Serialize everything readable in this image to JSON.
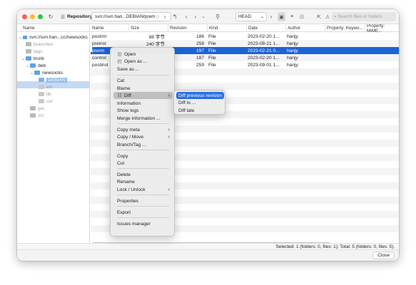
{
  "toolbar": {
    "repository_label": "Repository",
    "path": "svn://svn.han...DEBIAN/prem",
    "revision": "HEAD",
    "search_placeholder": "Search files or folders"
  },
  "tree": {
    "header": "Name",
    "items": [
      {
        "label": "svn://svn.han...cc/newsocks",
        "dim": false
      },
      {
        "label": "branches",
        "dim": true
      },
      {
        "label": "tags",
        "dim": true
      },
      {
        "label": "trunk",
        "dim": false
      },
      {
        "label": "deb",
        "dim": false
      },
      {
        "label": "newsocks",
        "dim": false
      },
      {
        "label": "DEBIAN",
        "dim": false
      },
      {
        "label": "etc",
        "dim": true
      },
      {
        "label": "lib",
        "dim": true
      },
      {
        "label": "usr",
        "dim": true
      },
      {
        "label": "gui",
        "dim": true
      },
      {
        "label": "src",
        "dim": true
      }
    ]
  },
  "table": {
    "columns": [
      "Name",
      "Size",
      "Revision",
      "Kind",
      "Date",
      "Author",
      "Property: Keywo...",
      "Property: MIME..."
    ],
    "rows": [
      {
        "name": "postrm",
        "size": "88 字节",
        "revision": "186",
        "kind": "File",
        "date": "2023-02-20 1...",
        "author": "hanjy"
      },
      {
        "name": "preinst",
        "size": "240 字节",
        "revision": "258",
        "kind": "File",
        "date": "2023-08-21 1...",
        "author": "hanjy"
      },
      {
        "name": "prerm",
        "size": "",
        "revision": "197",
        "kind": "File",
        "date": "2023-02-21 0...",
        "author": "hanjy"
      },
      {
        "name": "control",
        "size": "",
        "revision": "187",
        "kind": "File",
        "date": "2023-02-20 1...",
        "author": "hanjy"
      },
      {
        "name": "postinst",
        "size": "",
        "revision": "259",
        "kind": "File",
        "date": "2023-09-01 1...",
        "author": "hanjy"
      }
    ],
    "selected_row": 2
  },
  "context_menu": {
    "items": {
      "open": "Open",
      "open_as": "Open as ...",
      "save_as": "Save as ...",
      "cat": "Cat",
      "blame": "Blame",
      "diff": "Diff",
      "information": "Information",
      "show_logs": "Show logs",
      "merge_information": "Merge information ...",
      "copy_meta": "Copy meta",
      "copy_move": "Copy / Move",
      "branch_tag": "Branch/Tag ...",
      "copy": "Copy",
      "cut": "Cut",
      "delete": "Delete",
      "rename": "Rename",
      "lock_unlock": "Lock / Unlock",
      "properties": "Properties",
      "export": "Export",
      "issues_manager": "Issues manager"
    }
  },
  "diff_submenu": {
    "items": [
      "Diff previous revision",
      "Diff to ...",
      "Diff late"
    ]
  },
  "status": "Selected: 1 (folders: 0, files: 1); Total: 5 (folders: 0, files: 5).",
  "close_label": "Close"
}
